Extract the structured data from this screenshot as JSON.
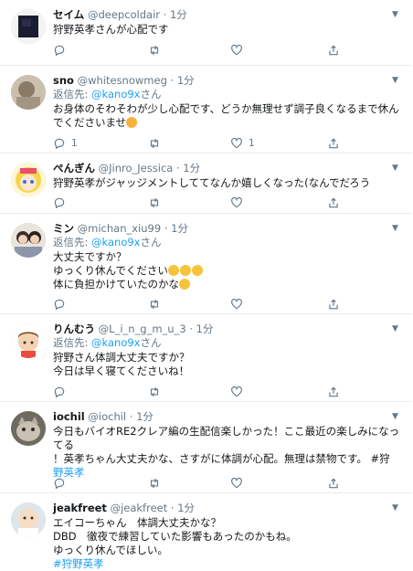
{
  "tweets": [
    {
      "display_name": "セイム",
      "handle": "@deepcoldair",
      "time": "1分",
      "reply_label": "",
      "reply_handle": "",
      "reply_suffix": "",
      "lines": [
        "狩野英孝さんが心配です"
      ],
      "hashtag": "",
      "reply_count": "",
      "like_count": "",
      "avatar": "dark-square-avatar"
    },
    {
      "display_name": "sno",
      "handle": "@whitesnowmeg",
      "time": "1分",
      "reply_label": "返信先: ",
      "reply_handle": "@kano9x",
      "reply_suffix": "さん",
      "lines": [
        "お身体のそわそわが少し心配です、どうか無理せず調子良くなるまで休ん",
        "でくださいませ"
      ],
      "hashtag": "",
      "reply_count": "1",
      "like_count": "1",
      "avatar": "photo-avatar"
    },
    {
      "display_name": "ぺんぎん",
      "handle": "@Jinro_Jessica",
      "time": "1分",
      "reply_label": "",
      "reply_handle": "",
      "reply_suffix": "",
      "lines": [
        "狩野英孝がジャッジメントしててなんか嬉しくなった(なんでだろう"
      ],
      "hashtag": "",
      "reply_count": "",
      "like_count": "",
      "avatar": "anime-avatar"
    },
    {
      "display_name": "ミン",
      "handle": "@michan_xiu99",
      "time": "1分",
      "reply_label": "返信先: ",
      "reply_handle": "@kano9x",
      "reply_suffix": "さん",
      "lines": [
        "大丈夫ですか？",
        "ゆっくり休んでください",
        "体に負担かけていたのかな"
      ],
      "hashtag": "",
      "reply_count": "",
      "like_count": "",
      "avatar": "couple-avatar"
    },
    {
      "display_name": "りんむう",
      "handle": "@L_i_n_g_m_u_3",
      "time": "1分",
      "reply_label": "返信先: ",
      "reply_handle": "@kano9x",
      "reply_suffix": "さん",
      "lines": [
        "狩野さん体調大丈夫ですか？",
        "今日は早く寝てくださいね！"
      ],
      "hashtag": "",
      "reply_count": "",
      "like_count": "",
      "avatar": "cartoon-boy-avatar"
    },
    {
      "display_name": "iochil",
      "handle": "@iochil",
      "time": "1分",
      "reply_label": "",
      "reply_handle": "",
      "reply_suffix": "",
      "lines": [
        "今日もバイオRE2クレア編の生配信楽しかった！ここ最近の楽しみになってる",
        "！英孝ちゃん大丈夫かな、さすがに体調が心配。無理は禁物です。 #狩",
        "野英孝"
      ],
      "hashtag": "",
      "reply_count": "",
      "like_count": "",
      "avatar": "cat-avatar"
    },
    {
      "display_name": "jeakfreet",
      "handle": "@jeakfreet",
      "time": "1分",
      "reply_label": "",
      "reply_handle": "",
      "reply_suffix": "",
      "lines": [
        "エイコーちゃん　体調大丈夫かな？",
        "DBD　徹夜で練習していた影響もあったのかもね。",
        "ゆっくり休んでほしい。",
        "#狩野英孝"
      ],
      "hashtag": "",
      "reply_count": "",
      "like_count": "",
      "avatar": "baby-avatar"
    }
  ],
  "icons": {
    "reply": "reply-icon",
    "retweet": "retweet-icon",
    "like": "heart-icon",
    "share": "share-icon",
    "more": "chevron-down-icon"
  },
  "colors": {
    "accent": "#1da1f2",
    "secondary_text": "#657786",
    "border": "#e6ecf0"
  }
}
